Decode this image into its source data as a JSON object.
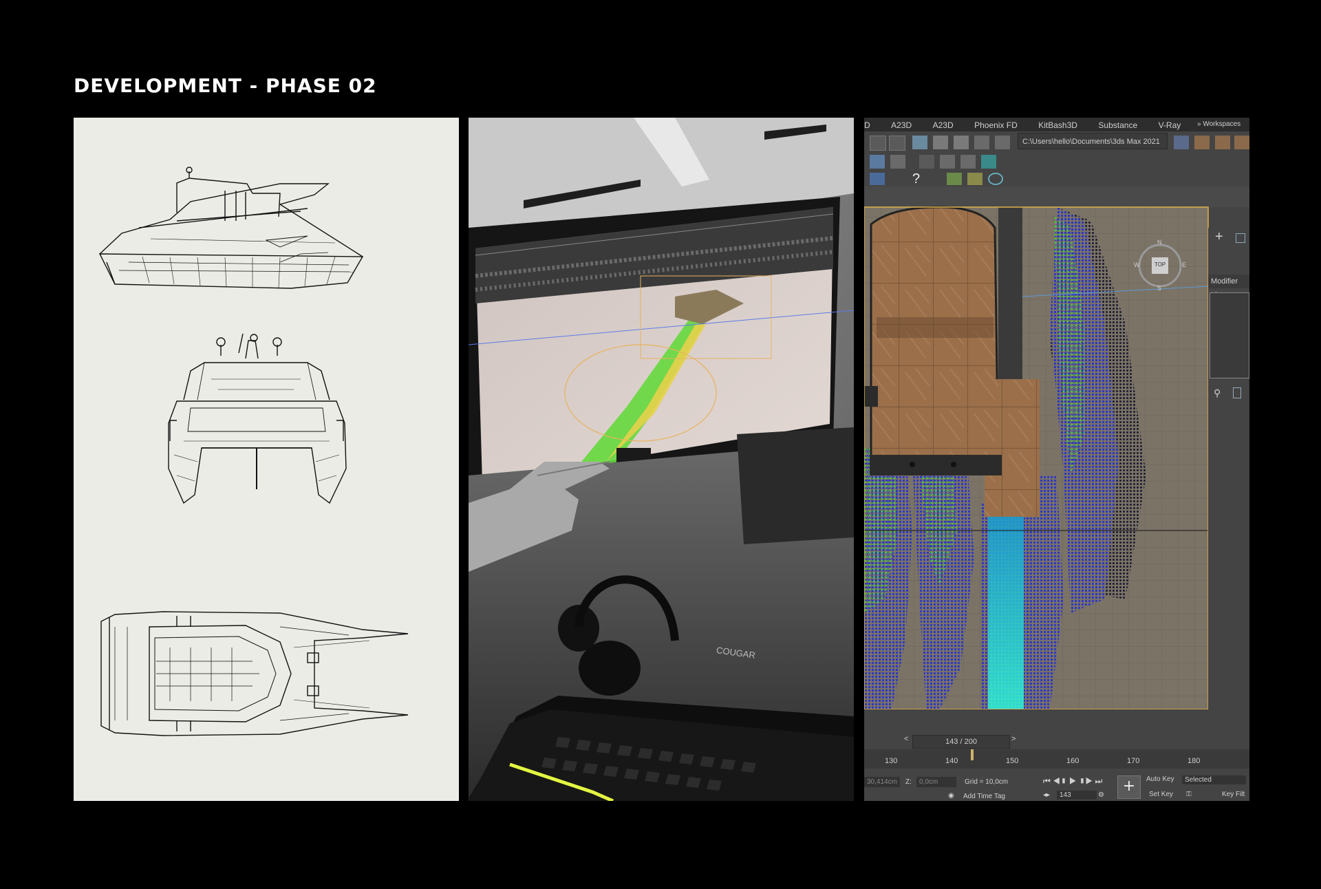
{
  "page": {
    "title": "DEVELOPMENT - PHASE 02"
  },
  "software": {
    "menu": [
      "D",
      "A23D",
      "A23D",
      "Phoenix FD",
      "KitBash3D",
      "Substance",
      "V-Ray"
    ],
    "workspaces_label": "Workspaces",
    "project_path": "C:\\Users\\hello\\Documents\\3ds Max 2021",
    "modifier_list_label": "Modifier List",
    "viewcube_label": "TOP",
    "compass": {
      "n": "N",
      "s": "S",
      "e": "E",
      "w": "W"
    },
    "time_slider": "143 / 200",
    "timeline_ticks": [
      "130",
      "140",
      "150",
      "160",
      "170",
      "180"
    ],
    "coord_x": "30,414cm",
    "z_label": "Z:",
    "coord_z": "0,0cm",
    "grid": "Grid = 10,0cm",
    "add_time_tag": "Add Time Tag",
    "auto_key": "Auto Key",
    "selected": "Selected",
    "set_key": "Set Key",
    "key_filters": "Key Filt",
    "frame": "143"
  },
  "keyboard_brand": "COUGAR",
  "colors": {
    "background": "#000000",
    "title": "#ffffff",
    "paper": "#ecece6",
    "particles_green": "#49c93a",
    "particles_blue": "#2b35c8",
    "particles_cyan": "#25e6d0",
    "deck_wood": "#9a6f4a"
  }
}
